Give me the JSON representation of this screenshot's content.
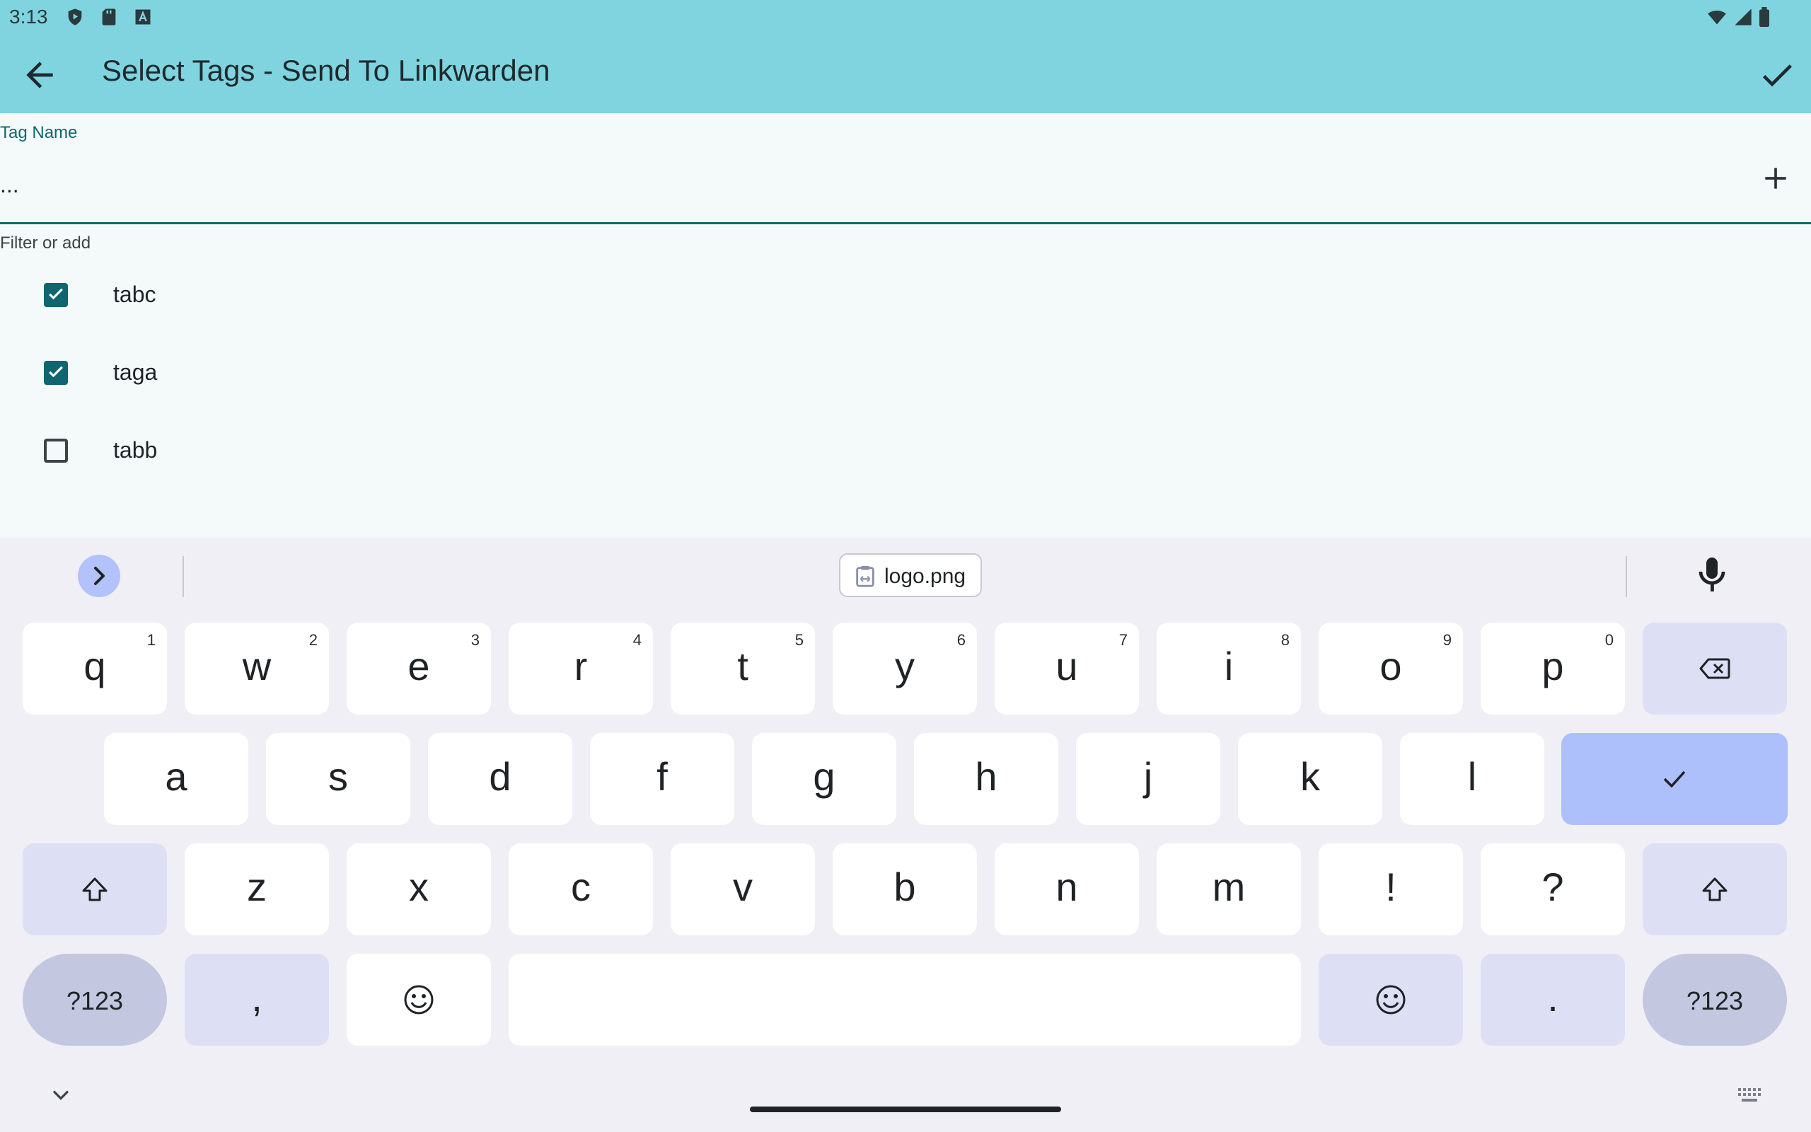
{
  "status_bar": {
    "time": "3:13",
    "left_icons": [
      "shield-play-icon",
      "sd-card-icon",
      "font-a-icon"
    ],
    "right_icons": [
      "wifi-icon",
      "cell-signal-icon",
      "battery-icon"
    ]
  },
  "app_bar": {
    "title": "Select Tags - Send To Linkwarden",
    "back_icon": "arrow-left-icon",
    "confirm_icon": "check-icon",
    "background": "#80d4df"
  },
  "tag_field": {
    "label": "Tag Name",
    "value": "...",
    "helper": "Filter or add",
    "add_icon": "plus-icon",
    "accent": "#12666f"
  },
  "tags": [
    {
      "label": "tabc",
      "checked": true
    },
    {
      "label": "taga",
      "checked": true
    },
    {
      "label": "tabb",
      "checked": false
    }
  ],
  "keyboard": {
    "clipboard_suggestion": "logo.png",
    "row1": [
      {
        "char": "q",
        "hint": "1"
      },
      {
        "char": "w",
        "hint": "2"
      },
      {
        "char": "e",
        "hint": "3"
      },
      {
        "char": "r",
        "hint": "4"
      },
      {
        "char": "t",
        "hint": "5"
      },
      {
        "char": "y",
        "hint": "6"
      },
      {
        "char": "u",
        "hint": "7"
      },
      {
        "char": "i",
        "hint": "8"
      },
      {
        "char": "o",
        "hint": "9"
      },
      {
        "char": "p",
        "hint": "0"
      }
    ],
    "row2": [
      "a",
      "s",
      "d",
      "f",
      "g",
      "h",
      "j",
      "k",
      "l"
    ],
    "row3": [
      "z",
      "x",
      "c",
      "v",
      "b",
      "n",
      "m",
      "!",
      "?"
    ],
    "symbols_label": "?123",
    "comma": ",",
    "period": ".",
    "enter_color": "#adc0fb"
  }
}
